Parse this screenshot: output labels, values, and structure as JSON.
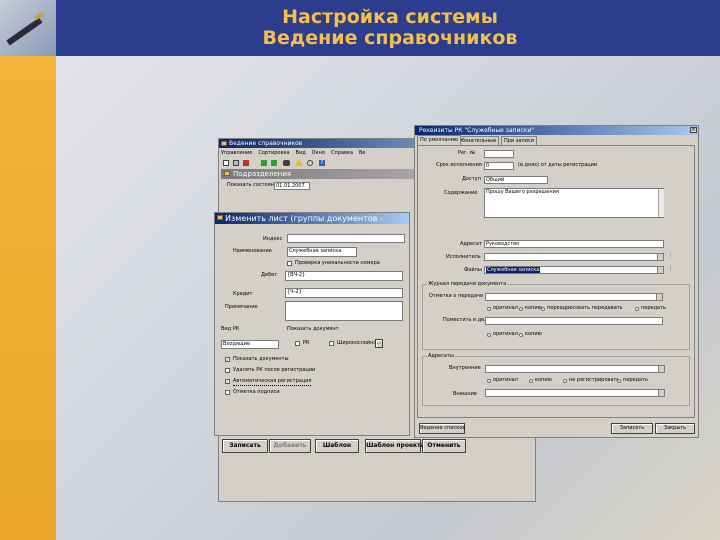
{
  "slide": {
    "title_line1": "Настройка системы",
    "title_line2": "Ведение справочников"
  },
  "main_window": {
    "title": "Ведение справочников",
    "menu": [
      "Управление",
      "Сортировка",
      "Вид",
      "Окно",
      "Справка",
      "Ве"
    ],
    "panel_title": "Подразделения",
    "state_label": "Показать состояние на",
    "state_date": "01.01.2007",
    "buttons": {
      "save": "Записать",
      "add": "Добавить",
      "template": "Шаблон",
      "template_project": "Шаблон проекта",
      "cancel": "Отменить"
    }
  },
  "edit_sheet": {
    "title": "Изменить лист (группы документов -",
    "index_label": "Индекс",
    "name_label": "Наименование",
    "name_value": "Служебная записка",
    "uniq_check_label": "Проверка уникальности номера",
    "debit_label": "Дебет",
    "debit_value": "{ВЧ-2}",
    "credit_label": "Кредит",
    "credit_value": "{Ч-2}",
    "note_label": "Примечание",
    "type_label": "Вид РК",
    "type_value": "Входящие",
    "check_labels": [
      "Показать документ",
      "РК",
      "Широкослойно"
    ],
    "opts": [
      "Показать документы",
      "Удалять РК после регистрации",
      "Автоматическая регистрация",
      "Отметка подписи"
    ]
  },
  "rk_dialog": {
    "title": "Реквизиты РК \"Служебные записки\"",
    "tabs": [
      "По умолчанию",
      "Обязательные",
      "При записи"
    ],
    "fields": {
      "num_label": "Рег. №",
      "exec_label": "Срок исполнения",
      "exec_value": "0",
      "exec_suffix": "(в днях) от даты регистрации",
      "access_label": "Доступ",
      "access_value": "Общий",
      "content_label": "Содержание",
      "content_value": "Прошу Вашего разрешения",
      "addressee_label": "Адресат",
      "addressee_value": "Руководство",
      "executor_label": "Исполнитель",
      "file_label": "Файлы",
      "file_value": "Служебная записка"
    },
    "journal_group": "Журнал передачи документа",
    "journal": {
      "transfer_label": "Отметка о передаче",
      "place_label": "Поместить в дело",
      "radio1": [
        "оригинал",
        "копию",
        "переадресовать передавать",
        "передать"
      ],
      "radio2": [
        "оригинал",
        "копию"
      ]
    },
    "addressees_group": "Адресаты",
    "addressees": {
      "internal_label": "Внутренние",
      "external_label": "Внешние",
      "radio": [
        "оригинал",
        "копию",
        "не регистрировать",
        "передать"
      ]
    },
    "buttons": {
      "journal": "Ведение списков",
      "save": "Записать",
      "close": "Закрыть"
    }
  },
  "colors": {
    "header": "#2b3d8c",
    "title": "#f3c04e",
    "sidebar": "#f2b43a",
    "titlebar": "#0a246a"
  }
}
